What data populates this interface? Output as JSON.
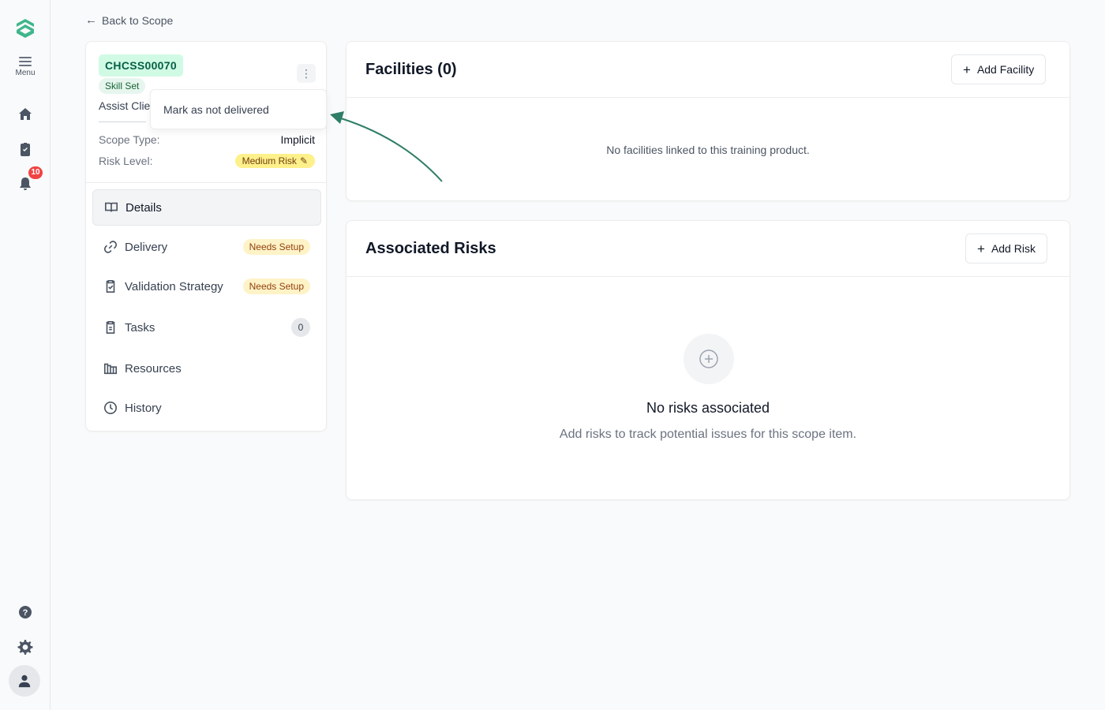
{
  "nav_rail": {
    "menu_label": "Menu",
    "notification_count": "10"
  },
  "back_link": {
    "label": "Back to Scope"
  },
  "scope_item": {
    "code": "CHCSS00070",
    "type_badge": "Skill Set",
    "title_truncated": "Assist Clie",
    "scope_type_label": "Scope Type:",
    "scope_type_value": "Implicit",
    "risk_level_label": "Risk Level:",
    "risk_level_value": "Medium Risk"
  },
  "dropdown": {
    "item": "Mark as not delivered"
  },
  "side_nav": {
    "items": [
      {
        "label": "Details",
        "icon": "book-open-icon",
        "active": true
      },
      {
        "label": "Delivery",
        "icon": "link-icon",
        "badge": "Needs Setup"
      },
      {
        "label": "Validation Strategy",
        "icon": "clipboard-check-icon",
        "badge": "Needs Setup"
      },
      {
        "label": "Tasks",
        "icon": "clipboard-icon",
        "count": "0"
      },
      {
        "label": "Resources",
        "icon": "library-icon"
      },
      {
        "label": "History",
        "icon": "clock-icon"
      }
    ]
  },
  "facilities": {
    "title": "Facilities (0)",
    "add_button": "Add Facility",
    "empty_text": "No facilities linked to this training product."
  },
  "risks": {
    "title": "Associated Risks",
    "add_button": "Add Risk",
    "empty_title": "No risks associated",
    "empty_subtitle": "Add risks to track potential issues for this scope item."
  },
  "colors": {
    "brand_green": "#3fb68b",
    "code_badge_bg": "#d1fae5",
    "risk_pill_bg": "#fef08a",
    "needs_setup_bg": "#fef3c7",
    "notification_red": "#ef4444",
    "annotation_arrow": "#2e7d66"
  }
}
